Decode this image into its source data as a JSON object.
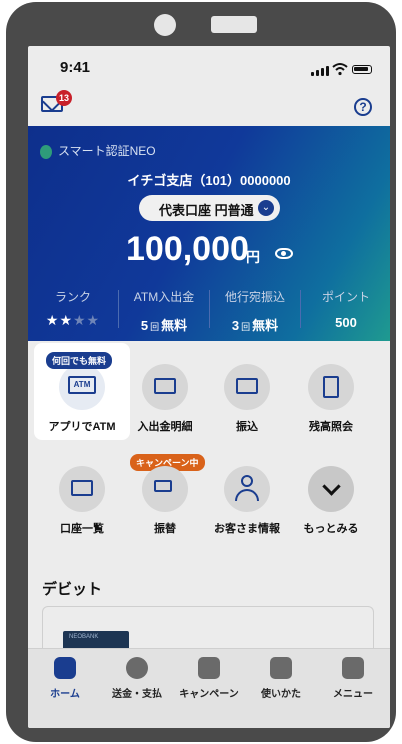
{
  "status_bar": {
    "time": "9:41"
  },
  "header": {
    "mail_badge": "13",
    "help_glyph": "?"
  },
  "account_card": {
    "security_label": "スマート認証NEO",
    "branch": "イチゴ支店（101）0000000",
    "account_selector": "代表口座 円普通",
    "balance": "100,000",
    "currency": "円",
    "stats": [
      {
        "label": "ランク",
        "value": "",
        "stars_filled": 2,
        "stars_total": 4
      },
      {
        "label": "ATM入出金",
        "count": "5",
        "unit": "回",
        "suffix": "無料"
      },
      {
        "label": "他行宛振込",
        "count": "3",
        "unit": "回",
        "suffix": "無料"
      },
      {
        "label": "ポイント",
        "count": "500",
        "unit": "",
        "suffix": ""
      }
    ]
  },
  "menu": {
    "row1": [
      {
        "label": "アプリでATM",
        "tag": "何回でも無料",
        "icon": "atm-icon",
        "icon_text": "ATM"
      },
      {
        "label": "入出金明細",
        "icon": "statement-icon"
      },
      {
        "label": "振込",
        "icon": "card-transfer-icon"
      },
      {
        "label": "残高照会",
        "icon": "calculator-icon"
      }
    ],
    "row2": [
      {
        "label": "口座一覧",
        "icon": "account-list-icon"
      },
      {
        "label": "振替",
        "tag": "キャンペーン中",
        "icon": "swap-icon"
      },
      {
        "label": "お客さま情報",
        "icon": "person-icon"
      },
      {
        "label": "もっとみる",
        "icon": "chevron-down-icon"
      }
    ]
  },
  "debit": {
    "title": "デビット",
    "card_brand": "NEOBANK"
  },
  "tabbar": [
    {
      "label": "ホーム",
      "icon": "home-icon"
    },
    {
      "label": "送金・支払",
      "icon": "yen-icon"
    },
    {
      "label": "キャンペーン",
      "icon": "gift-icon"
    },
    {
      "label": "使いかた",
      "icon": "book-icon"
    },
    {
      "label": "メニュー",
      "icon": "grid-icon"
    }
  ],
  "colors": {
    "primary": "#1a3d8f",
    "badge": "#c8202a",
    "tag_orange": "#d9621a",
    "tag_blue": "#1a3d8f"
  }
}
